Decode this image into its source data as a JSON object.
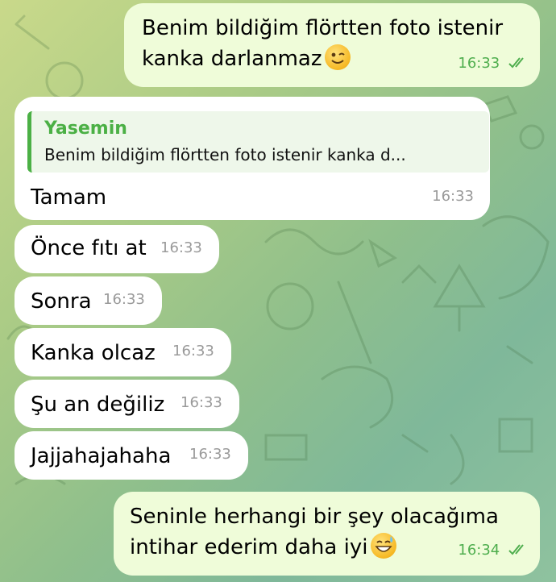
{
  "messages": [
    {
      "lines": [
        "Benim bildiğim flörtten foto istenir",
        "kanka darlanmaz"
      ],
      "emoji": "winking-face",
      "time": "16:33",
      "direction": "outgoing",
      "status": "read"
    },
    {
      "reply_to": {
        "name": "Yasemin",
        "text": "Benim bildiğim flörtten foto istenir kanka d..."
      },
      "text": "Tamam",
      "time": "16:33",
      "direction": "incoming"
    },
    {
      "text": "Önce fıtı at",
      "time": "16:33",
      "direction": "incoming"
    },
    {
      "text": "Sonra",
      "time": "16:33",
      "direction": "incoming"
    },
    {
      "text": "Kanka olcaz",
      "time": "16:33",
      "direction": "incoming"
    },
    {
      "text": "Şu an değiliz",
      "time": "16:33",
      "direction": "incoming"
    },
    {
      "text": "Jajjahajahaha",
      "time": "16:33",
      "direction": "incoming"
    },
    {
      "lines": [
        "Seninle herhangi bir şey olacağıma",
        "intihar ederim daha iyi"
      ],
      "emoji": "grinning-face-with-sweat",
      "time": "16:34",
      "direction": "outgoing",
      "status": "read"
    }
  ],
  "colors": {
    "incoming_bubble": "#ffffff",
    "outgoing_bubble": "#effcd9",
    "accent": "#4bb045",
    "time_gray": "#9a9a9a"
  }
}
